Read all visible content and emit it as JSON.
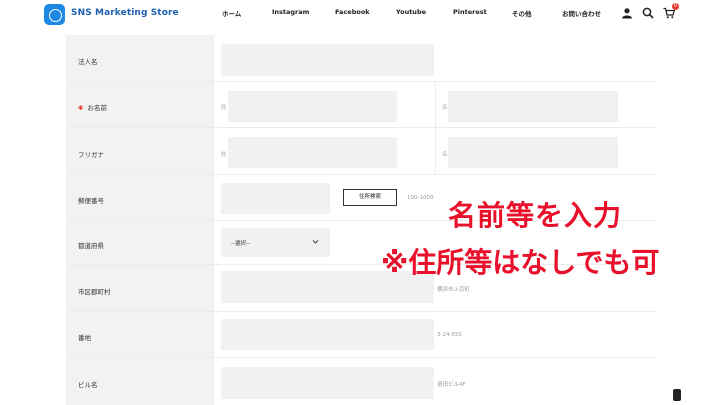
{
  "header": {
    "brand": "SNS Marketing Store",
    "nav": [
      "ホーム",
      "Instagram",
      "Facebook",
      "Youtube",
      "Pinterest",
      "その他",
      "お問い合わせ"
    ],
    "cart_count": "0"
  },
  "form": {
    "corporate_name": {
      "label": "法人名",
      "value": ""
    },
    "name": {
      "required_mark": "✱",
      "label": "お名前",
      "last_sub": "姓",
      "first_sub": "名",
      "last_value": "",
      "first_value": ""
    },
    "furigana": {
      "label": "フリガナ",
      "last_sub": "姓",
      "first_sub": "名"
    },
    "postal": {
      "label": "郵便番号",
      "button": "住所検索",
      "hint": "100-1000"
    },
    "prefecture": {
      "label": "都道府県",
      "selected": "--選択--"
    },
    "city": {
      "label": "市区郡町村",
      "hint": "横浜市上京町"
    },
    "street": {
      "label": "番地",
      "hint": "3-24-555"
    },
    "building": {
      "label": "ビル名",
      "hint": "酒田ビル4F"
    }
  },
  "overlay": {
    "line1": "名前等を入力",
    "line2": "※住所等はなしでも可"
  }
}
